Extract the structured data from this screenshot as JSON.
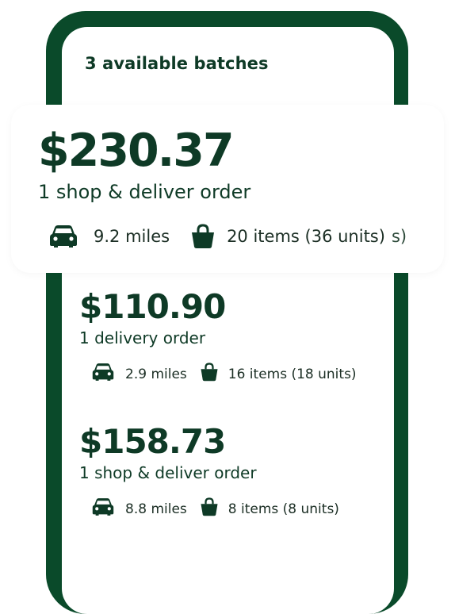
{
  "header": {
    "batches_count": "3 available batches"
  },
  "featured_batch": {
    "price": "$230.37",
    "order_type": "1 shop & deliver order",
    "distance": "9.2 miles",
    "items": "20 items (36 units)",
    "extra": "s)"
  },
  "batches": [
    {
      "price": "$110.90",
      "order_type": "1 delivery order",
      "distance": "2.9 miles",
      "items": "16 items (18 units)"
    },
    {
      "price": "$158.73",
      "order_type": "1 shop & deliver order",
      "distance": "8.8 miles",
      "items": "8 items (8 units)"
    }
  ],
  "icons": {
    "distance": "car-icon",
    "items": "shopping-bag-icon"
  },
  "colors": {
    "brand_green": "#0a4a2a",
    "text_dark_green": "#0e3a26"
  }
}
